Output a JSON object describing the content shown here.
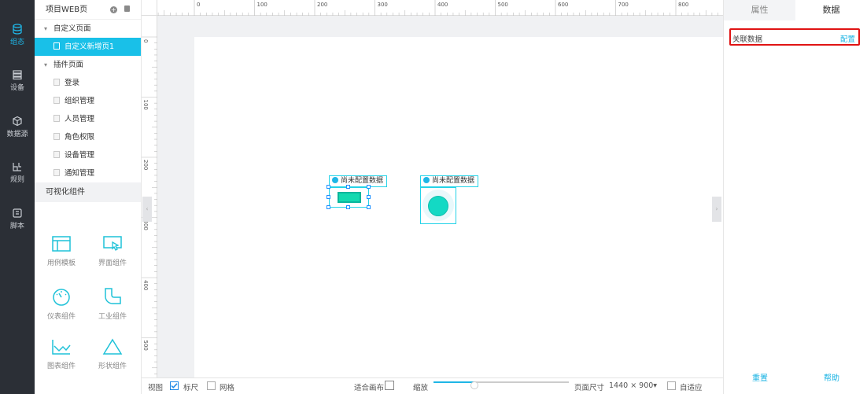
{
  "rail": {
    "items": [
      {
        "label": "组态",
        "icon": "database-icon",
        "active": true
      },
      {
        "label": "设备",
        "icon": "device-list-icon",
        "active": false
      },
      {
        "label": "数据源",
        "icon": "cube-icon",
        "active": false
      },
      {
        "label": "规则",
        "icon": "rule-icon",
        "active": false
      },
      {
        "label": "脚本",
        "icon": "script-icon",
        "active": false
      }
    ]
  },
  "tree": {
    "title": "项目WEB页",
    "custom_group": "自定义页面",
    "custom_pages": [
      "自定义新增页1"
    ],
    "plugin_group": "插件页面",
    "plugin_pages": [
      "登录",
      "组织管理",
      "人员管理",
      "角色权限",
      "设备管理",
      "通知管理"
    ]
  },
  "components": {
    "title": "可视化组件",
    "items": [
      "用例模板",
      "界面组件",
      "仪表组件",
      "工业组件",
      "图表组件",
      "形状组件"
    ]
  },
  "ruler": {
    "top": [
      "0",
      "100",
      "200",
      "300",
      "400",
      "500",
      "600",
      "700",
      "800"
    ],
    "left": [
      "0",
      "100",
      "200",
      "300",
      "400",
      "500"
    ]
  },
  "canvas": {
    "widget1_tag": "尚未配置数据",
    "widget2_tag": "尚未配置数据"
  },
  "bottom": {
    "view": "视图",
    "ruler": "标尺",
    "grid": "网格",
    "fit": "适合画布",
    "zoom": "缩放",
    "zoom_level": 0.3,
    "page_size_label": "页面尺寸",
    "page_size": "1440 × 900▾",
    "adaptive": "自适应"
  },
  "rpanel": {
    "tab_props": "属性",
    "tab_data": "数据",
    "relate_label": "关联数据",
    "relate_action": "配置",
    "reset": "重置",
    "help": "帮助"
  }
}
